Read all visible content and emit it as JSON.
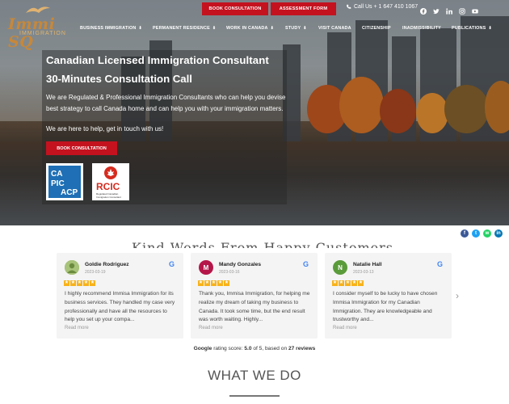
{
  "brand": {
    "logo_text": "Immi SQ",
    "logo_subtitle": "IMMIGRATION"
  },
  "topbar": {
    "book_label": "BOOK CONSULTATION",
    "assessment_label": "ASSESSMENT FORM",
    "call_label": "Call Us + 1 647 410 1067",
    "social": [
      "facebook-icon",
      "twitter-icon",
      "linkedin-icon",
      "instagram-icon",
      "youtube-icon"
    ]
  },
  "nav": {
    "items": [
      {
        "label": "BUSINESS IMMIGRATION",
        "has_dropdown": true
      },
      {
        "label": "PERMANENT RESIDENCE",
        "has_dropdown": true
      },
      {
        "label": "WORK IN CANADA",
        "has_dropdown": true
      },
      {
        "label": "STUDY",
        "has_dropdown": true
      },
      {
        "label": "VISIT CANADA",
        "has_dropdown": false
      },
      {
        "label": "CITIZENSHIP",
        "has_dropdown": false
      },
      {
        "label": "INADMISSIBILITY",
        "has_dropdown": false
      },
      {
        "label": "PUBLICATIONS",
        "has_dropdown": true
      }
    ]
  },
  "hero": {
    "title_line1": "Canadian Licensed Immigration Consultant",
    "title_line2": "30-Minutes Consultation Call",
    "paragraph": "We are Regulated & Professional Immigration Consultants who can help you devise best strategy to call Canada home and can help you with your immigration matters.",
    "paragraph2": "We are here to help, get in touch with us!",
    "button_label": "BOOK CONSULTATION",
    "badge1_text": "CAPIC ACCP",
    "badge2_text": "RCIC",
    "badge2_sub": "Regulated Canadian Immigration Consultant"
  },
  "share": [
    "facebook-icon",
    "twitter-icon",
    "whatsapp-icon",
    "linkedin-icon"
  ],
  "reviews_section": {
    "title": "Kind Words From Happy Customers",
    "reviews": [
      {
        "name": "Goldie Rodriguez",
        "date": "2023-03-19",
        "initial": "",
        "avatar_color": "#8aa75a",
        "rating": 5,
        "text": "I highly recommend Immisa Immigration for its business services. They handled my case very professionally and have all the resources to help you set up your compa...",
        "more": "Read more"
      },
      {
        "name": "Mandy Gonzales",
        "date": "2023-03-16",
        "initial": "M",
        "avatar_color": "#b5164a",
        "rating": 5,
        "text": "Thank you, Immisa Immigration, for helping me realize my dream of taking my business to Canada. It took some time, but the end result was worth waiting. Highly...",
        "more": "Read more"
      },
      {
        "name": "Natalie Hall",
        "date": "2023-03-13",
        "initial": "N",
        "avatar_color": "#5a9b3a",
        "rating": 5,
        "text": "I consider myself to be lucky to have chosen Immisa Immigration for my Canadian Immigration. They are knowledgeable and trustworthy and...",
        "more": "Read more"
      }
    ],
    "rating_prefix": "Google",
    "rating_mid": "rating score:",
    "rating_score": "5.0",
    "rating_of": "of 5, based on",
    "rating_count": "27 reviews"
  },
  "what_we_do": {
    "title": "WHAT WE DO"
  },
  "colors": {
    "accent_red": "#c4121f",
    "star": "#f7b21b",
    "brand_gold": "#c7883a"
  }
}
